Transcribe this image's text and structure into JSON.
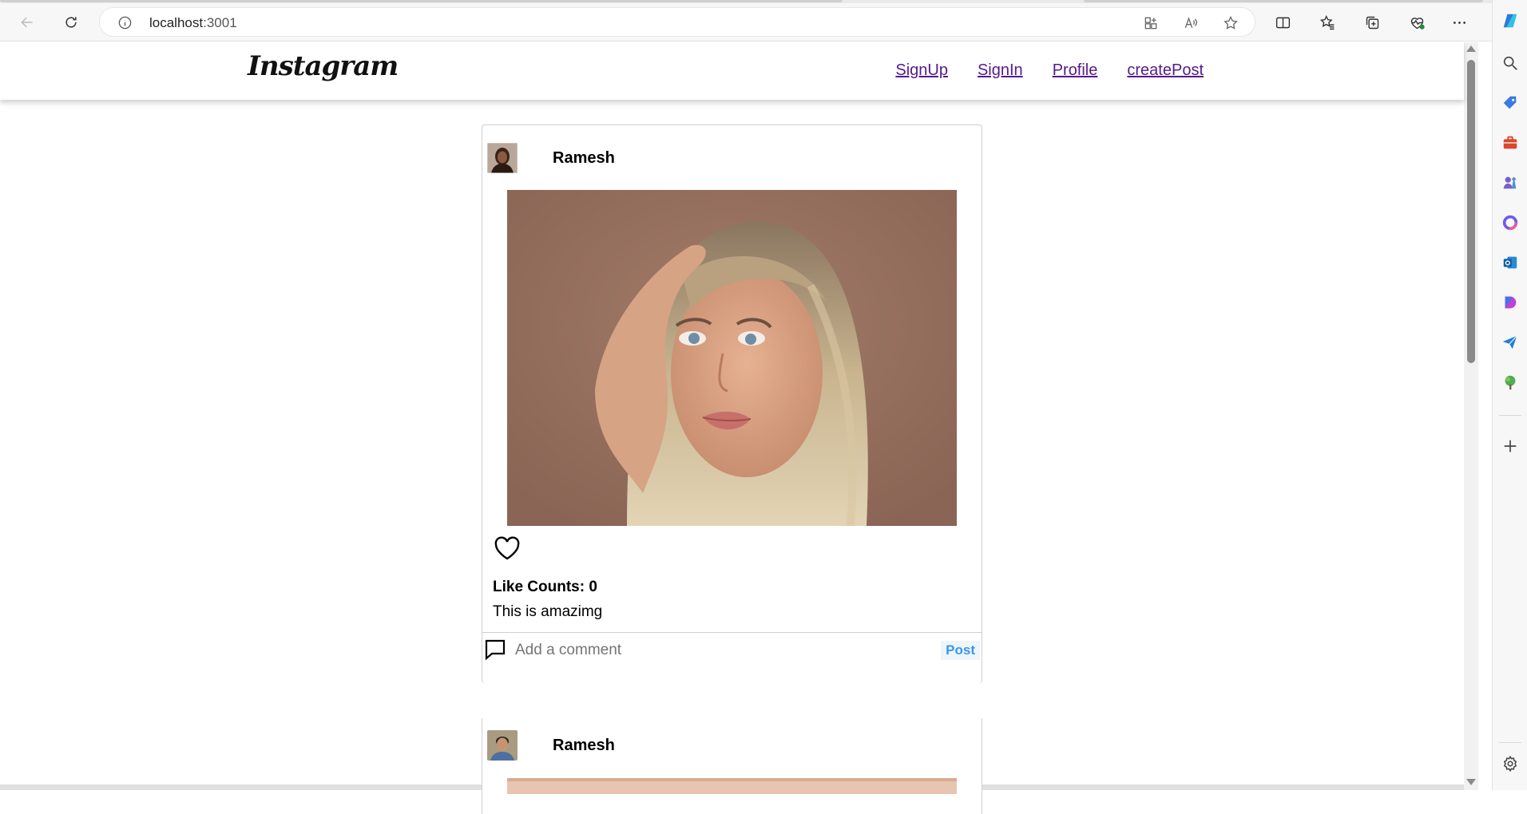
{
  "browser": {
    "url_host": "localhost",
    "url_port": ":3001"
  },
  "site": {
    "logo": "Instagram",
    "nav": [
      {
        "label": "SignUp"
      },
      {
        "label": "SignIn"
      },
      {
        "label": "Profile"
      },
      {
        "label": "createPost"
      }
    ]
  },
  "posts": [
    {
      "username": "Ramesh",
      "like_label": "Like Counts: 0",
      "caption": "This is amazimg",
      "comment_placeholder": "Add a comment",
      "post_button": "Post"
    },
    {
      "username": "Ramesh"
    }
  ],
  "colors": {
    "link": "#551a8b",
    "post_button": "#3897f0"
  }
}
